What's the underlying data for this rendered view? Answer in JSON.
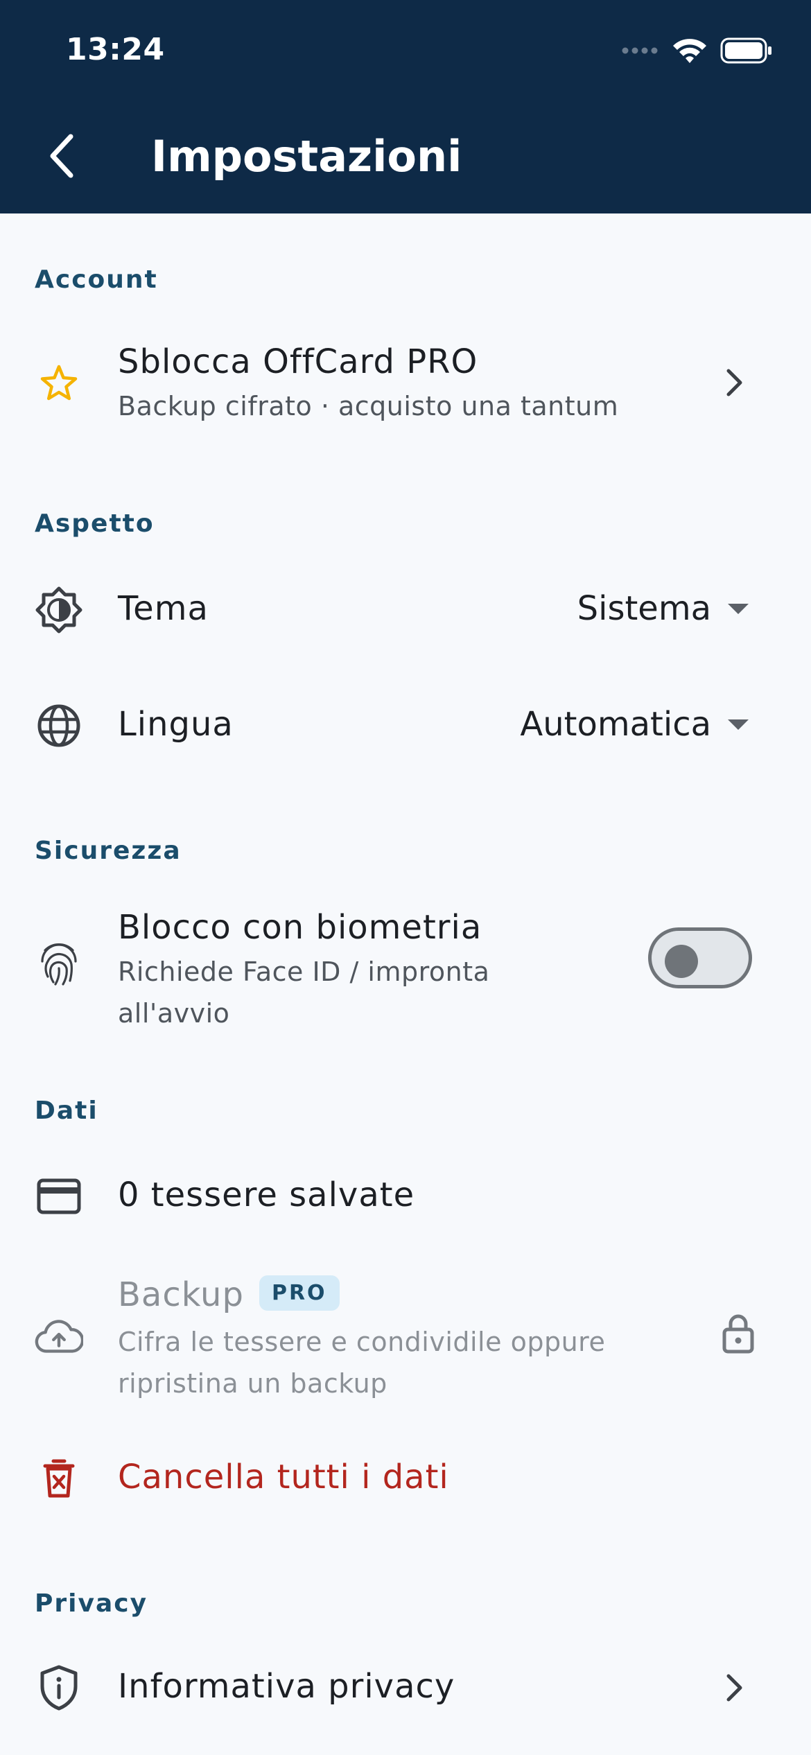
{
  "status_bar": {
    "time": "13:24"
  },
  "app_bar": {
    "title": "Impostazioni"
  },
  "sections": {
    "account": {
      "header": "Account",
      "unlock_pro": {
        "title": "Sblocca OffCard PRO",
        "subtitle": "Backup cifrato · acquisto una tantum"
      }
    },
    "appearance": {
      "header": "Aspetto",
      "theme": {
        "label": "Tema",
        "value": "Sistema"
      },
      "language": {
        "label": "Lingua",
        "value": "Automatica"
      }
    },
    "security": {
      "header": "Sicurezza",
      "biometric_lock": {
        "title": "Blocco con biometria",
        "subtitle": "Richiede Face ID / impronta all'avvio",
        "enabled": false
      }
    },
    "data": {
      "header": "Dati",
      "saved_cards": {
        "label": "0 tessere salvate"
      },
      "backup": {
        "title": "Backup",
        "badge": "PRO",
        "subtitle": "Cifra le tessere e condividile oppure ripristina un backup",
        "locked": true
      },
      "delete_all": {
        "label": "Cancella tutti i dati"
      }
    },
    "privacy": {
      "header": "Privacy",
      "policy": {
        "label": "Informativa privacy"
      }
    }
  },
  "colors": {
    "app_bar": "#0e2a47",
    "background": "#f7f9fc",
    "section_header": "#1b4d6b",
    "star": "#f5b301",
    "danger": "#b3261e",
    "badge_bg": "#d5ebf8"
  },
  "icons": {
    "back": "chevron-left-icon",
    "unlock_pro": "star-icon",
    "theme": "brightness-icon",
    "language": "globe-icon",
    "biometric": "fingerprint-icon",
    "cards": "credit-card-icon",
    "backup": "cloud-upload-icon",
    "backup_lock": "lock-icon",
    "delete": "trash-icon",
    "privacy": "shield-info-icon"
  }
}
